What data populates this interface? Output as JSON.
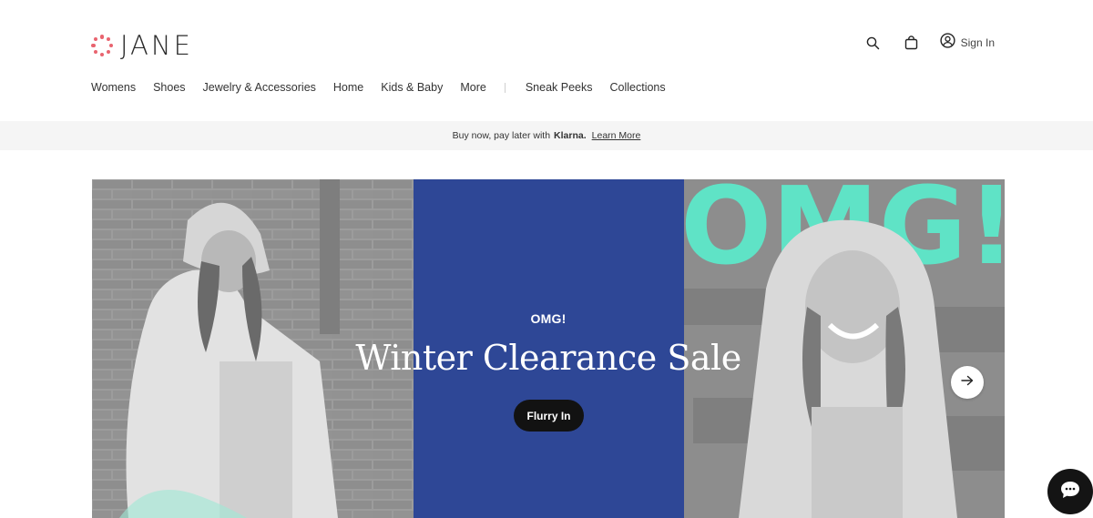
{
  "brand": {
    "name": "JANE",
    "accent": "#e8646f"
  },
  "header": {
    "search_icon": "search-icon",
    "bag_icon": "shopping-bag-icon",
    "account_icon": "user-circle-icon",
    "signin_label": "Sign In"
  },
  "nav": {
    "items": [
      "Womens",
      "Shoes",
      "Jewelry & Accessories",
      "Home",
      "Kids & Baby",
      "More"
    ],
    "secondary": [
      "Sneak Peeks",
      "Collections"
    ]
  },
  "promo": {
    "text": "Buy now, pay later with",
    "provider": "Klarna.",
    "link": "Learn More"
  },
  "hero": {
    "eyebrow": "OMG!",
    "title": "Winter Clearance Sale",
    "cta": "Flurry In",
    "overlay_text": "OMG!",
    "panel_color": "#2e4796",
    "overlay_color": "#5fe3c6",
    "next_icon": "arrow-right-icon"
  },
  "chat": {
    "icon": "chat-bubble-icon"
  }
}
